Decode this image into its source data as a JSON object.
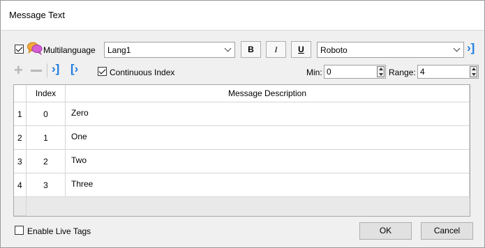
{
  "window": {
    "title": "Message Text"
  },
  "toolbar": {
    "multilanguage_label": "Multilanguage",
    "multilanguage_checked": true,
    "language_value": "Lang1",
    "bold_label": "B",
    "italic_label": "I",
    "underline_label": "U",
    "font_value": "Roboto",
    "continuous_index_label": "Continuous Index",
    "continuous_index_checked": true,
    "min_label": "Min:",
    "min_value": "0",
    "range_label": "Range:",
    "range_value": "4"
  },
  "table": {
    "columns": [
      "Index",
      "Message Description"
    ],
    "rows": [
      {
        "row_num": "1",
        "index": "0",
        "description": "Zero"
      },
      {
        "row_num": "2",
        "index": "1",
        "description": "One"
      },
      {
        "row_num": "3",
        "index": "2",
        "description": "Two"
      },
      {
        "row_num": "4",
        "index": "3",
        "description": "Three"
      }
    ]
  },
  "footer": {
    "enable_live_tags_label": "Enable Live Tags",
    "ok_label": "OK",
    "cancel_label": "Cancel"
  },
  "colors": {
    "accent": "#1c7be0",
    "disabled_icon": "#b7b7b7"
  }
}
